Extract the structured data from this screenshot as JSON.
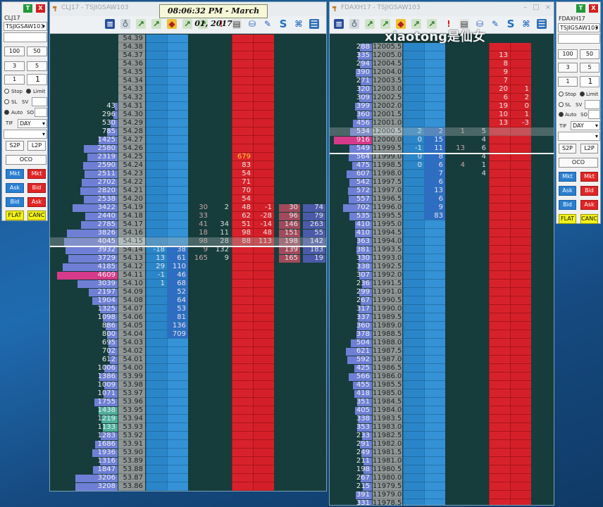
{
  "left_sidebar": {
    "symbol": "CLJ17",
    "account": "TSJIGSAW103",
    "qty_buttons": [
      "100",
      "50",
      "3",
      "5",
      "1"
    ],
    "qty_value": "1",
    "stop_label": "Stop",
    "limit_label": "Limit",
    "sl_label": "SL",
    "sv_label": "SV",
    "auto_label": "Auto",
    "so_label": "SO",
    "tif_label": "TIF",
    "tif_value": "DAY",
    "s2p": "S2P",
    "l2p": "L2P",
    "oco": "OCO",
    "mkt_buy": "Mkt",
    "mkt_sell": "Mkt",
    "ask_buy": "Ask",
    "bid_sell": "Bid",
    "bid_buy": "Bid",
    "ask_sell": "Ask",
    "flat": "FLAT",
    "canc": "CANC"
  },
  "right_sidebar": {
    "symbol": "FDAXH17",
    "account": "TSJIGSAW103",
    "qty_buttons": [
      "100",
      "50",
      "3",
      "5",
      "1"
    ],
    "qty_value": "1",
    "stop_label": "Stop",
    "limit_label": "Limit",
    "sl_label": "SL",
    "sv_label": "SV",
    "auto_label": "Auto",
    "so_label": "SO",
    "tif_label": "TIF",
    "tif_value": "DAY",
    "s2p": "S2P",
    "l2p": "L2P",
    "oco": "OCO",
    "mkt_buy": "Mkt",
    "mkt_sell": "Mkt",
    "ask_buy": "Ask",
    "bid_sell": "Bid",
    "bid_buy": "Bid",
    "ask_sell": "Ask",
    "flat": "FLAT",
    "canc": "CANC"
  },
  "window_left": {
    "title": "CLJ17 - TSJIGSAW103"
  },
  "window_right": {
    "title": "FDAXH17 - TSJIGSAW103"
  },
  "clock": "08:06:32 PM - March 01, 2017",
  "watermark": "xiaotong是仙女",
  "colors": {
    "ask": "#2b86c9",
    "bid": "#d8222b",
    "price": "#8e9696",
    "bg": "#173c3c",
    "volbar": "#6f7fd6"
  },
  "ladder_left": {
    "rows": [
      {
        "vol": "",
        "p": "54.39"
      },
      {
        "vol": "",
        "p": "54.38"
      },
      {
        "vol": "",
        "p": "54.37"
      },
      {
        "vol": "",
        "p": "54.36"
      },
      {
        "vol": "",
        "p": "54.35"
      },
      {
        "vol": "",
        "p": "54.34"
      },
      {
        "vol": "",
        "p": "54.33"
      },
      {
        "vol": "",
        "p": "54.32"
      },
      {
        "vol": "43",
        "p": "54.31"
      },
      {
        "vol": "296",
        "p": "54.30"
      },
      {
        "vol": "530",
        "p": "54.29"
      },
      {
        "vol": "785",
        "p": "54.28"
      },
      {
        "vol": "1425",
        "p": "54.27"
      },
      {
        "vol": "2580",
        "p": "54.26"
      },
      {
        "vol": "2319",
        "p": "54.25",
        "b1": "679"
      },
      {
        "vol": "2590",
        "p": "54.24",
        "b1": "83"
      },
      {
        "vol": "2511",
        "p": "54.23",
        "b1": "54"
      },
      {
        "vol": "2702",
        "p": "54.22",
        "b1": "71"
      },
      {
        "vol": "2820",
        "p": "54.21",
        "b1": "70"
      },
      {
        "vol": "2538",
        "p": "54.20",
        "b1": "54"
      },
      {
        "vol": "3422",
        "p": "54.19",
        "c1": "30",
        "c2": "2",
        "b1": "48",
        "b2": "-1",
        "d1": "30",
        "d2": "74"
      },
      {
        "vol": "2440",
        "p": "54.18",
        "c1": "33",
        "b1": "62",
        "b2": "-28",
        "d1": "96",
        "d2": "79"
      },
      {
        "vol": "2785",
        "p": "54.17",
        "c1": "41",
        "c2": "34",
        "b1": "51",
        "b2": "-14",
        "d1": "146",
        "d2": "263"
      },
      {
        "vol": "3826",
        "p": "54.16",
        "c1": "18",
        "c2": "11",
        "b1": "98",
        "b2": "48",
        "d1": "151",
        "d2": "55"
      },
      {
        "vol": "4045",
        "p": "54.15",
        "c1": "98",
        "c2": "28",
        "b1": "88",
        "b2": "113",
        "d1": "198",
        "d2": "142"
      },
      {
        "vol": "3932",
        "p": "54.14",
        "a1": "-18",
        "a2": "38",
        "c1": "9",
        "c2": "132",
        "d1": "139",
        "d2": "183"
      },
      {
        "vol": "3729",
        "p": "54.13",
        "a1": "13",
        "a2": "61",
        "c1": "165",
        "c2": "9",
        "d1": "165",
        "d2": "19"
      },
      {
        "vol": "4185",
        "p": "54.12",
        "a1": "29",
        "a2": "110"
      },
      {
        "vol": "4609",
        "p": "54.11",
        "a1": "-1",
        "a2": "46"
      },
      {
        "vol": "3039",
        "p": "54.10",
        "a1": "1",
        "a2": "68"
      },
      {
        "vol": "2197",
        "p": "54.09",
        "a2": "52"
      },
      {
        "vol": "1904",
        "p": "54.08",
        "a2": "64"
      },
      {
        "vol": "1325",
        "p": "54.07",
        "a2": "53"
      },
      {
        "vol": "1098",
        "p": "54.06",
        "a2": "81"
      },
      {
        "vol": "886",
        "p": "54.05",
        "a2": "136"
      },
      {
        "vol": "800",
        "p": "54.04",
        "a2": "709"
      },
      {
        "vol": "695",
        "p": "54.03"
      },
      {
        "vol": "702",
        "p": "54.02"
      },
      {
        "vol": "612",
        "p": "54.01"
      },
      {
        "vol": "1006",
        "p": "54.00"
      },
      {
        "vol": "1386",
        "p": "53.99"
      },
      {
        "vol": "1009",
        "p": "53.98"
      },
      {
        "vol": "1071",
        "p": "53.97"
      },
      {
        "vol": "1755",
        "p": "53.96"
      },
      {
        "vol": "1438",
        "p": "53.95"
      },
      {
        "vol": "1219",
        "p": "53.94"
      },
      {
        "vol": "1133",
        "p": "53.93"
      },
      {
        "vol": "1283",
        "p": "53.92"
      },
      {
        "vol": "1686",
        "p": "53.91"
      },
      {
        "vol": "1936",
        "p": "53.90"
      },
      {
        "vol": "1316",
        "p": "53.89"
      },
      {
        "vol": "1847",
        "p": "53.88"
      },
      {
        "vol": "3206",
        "p": "53.87"
      },
      {
        "vol": "3208",
        "p": "53.86"
      }
    ]
  },
  "ladder_right": {
    "rows": [
      {
        "vol": "288",
        "p": "12005.5"
      },
      {
        "vol": "335",
        "p": "12005.0",
        "b1": "13"
      },
      {
        "vol": "294",
        "p": "12004.5",
        "b1": "8"
      },
      {
        "vol": "390",
        "p": "12004.0",
        "b1": "9"
      },
      {
        "vol": "271",
        "p": "12003.5",
        "b1": "7"
      },
      {
        "vol": "320",
        "p": "12003.0",
        "b1": "20",
        "b2": "1"
      },
      {
        "vol": "309",
        "p": "12002.5",
        "b1": "6",
        "b2": "2"
      },
      {
        "vol": "399",
        "p": "12002.0",
        "b1": "19",
        "b2": "0"
      },
      {
        "vol": "360",
        "p": "12001.5",
        "b1": "10",
        "b2": "1"
      },
      {
        "vol": "456",
        "p": "12001.0",
        "b1": "13",
        "b2": "-3"
      },
      {
        "vol": "534",
        "p": "12000.5",
        "a1": "2",
        "a2": "2",
        "c1": "1",
        "c2": "5"
      },
      {
        "vol": "916",
        "p": "12000.0",
        "a1": "0",
        "a2": "15",
        "c2": "4"
      },
      {
        "vol": "549",
        "p": "11999.5",
        "a1": "-1",
        "a2": "11",
        "c1": "13",
        "c2": "6"
      },
      {
        "vol": "564",
        "p": "11999.0",
        "a1": "0",
        "a2": "8",
        "c2": "4"
      },
      {
        "vol": "475",
        "p": "11998.5",
        "a1": "0",
        "a2": "6",
        "c1": "4",
        "c2": "1"
      },
      {
        "vol": "607",
        "p": "11998.0",
        "a2": "7",
        "c2": "4"
      },
      {
        "vol": "542",
        "p": "11997.5",
        "a2": "6"
      },
      {
        "vol": "572",
        "p": "11997.0",
        "a2": "13"
      },
      {
        "vol": "557",
        "p": "11996.5",
        "a2": "6"
      },
      {
        "vol": "702",
        "p": "11996.0",
        "a2": "9"
      },
      {
        "vol": "535",
        "p": "11995.5",
        "a2": "83"
      },
      {
        "vol": "410",
        "p": "11995.0"
      },
      {
        "vol": "410",
        "p": "11994.5"
      },
      {
        "vol": "363",
        "p": "11994.0"
      },
      {
        "vol": "381",
        "p": "11993.5"
      },
      {
        "vol": "330",
        "p": "11993.0"
      },
      {
        "vol": "338",
        "p": "11992.5"
      },
      {
        "vol": "307",
        "p": "11992.0"
      },
      {
        "vol": "236",
        "p": "11991.5"
      },
      {
        "vol": "299",
        "p": "11991.0"
      },
      {
        "vol": "267",
        "p": "11990.5"
      },
      {
        "vol": "317",
        "p": "11990.0"
      },
      {
        "vol": "337",
        "p": "11989.5"
      },
      {
        "vol": "360",
        "p": "11989.0"
      },
      {
        "vol": "378",
        "p": "11988.5"
      },
      {
        "vol": "504",
        "p": "11988.0"
      },
      {
        "vol": "621",
        "p": "11987.5"
      },
      {
        "vol": "592",
        "p": "11987.0"
      },
      {
        "vol": "425",
        "p": "11986.5"
      },
      {
        "vol": "566",
        "p": "11986.0"
      },
      {
        "vol": "455",
        "p": "11985.5"
      },
      {
        "vol": "418",
        "p": "11985.0"
      },
      {
        "vol": "351",
        "p": "11984.5"
      },
      {
        "vol": "405",
        "p": "11984.0"
      },
      {
        "vol": "338",
        "p": "11983.5"
      },
      {
        "vol": "353",
        "p": "11983.0"
      },
      {
        "vol": "233",
        "p": "11982.5"
      },
      {
        "vol": "291",
        "p": "11982.0"
      },
      {
        "vol": "249",
        "p": "11981.5"
      },
      {
        "vol": "211",
        "p": "11981.0"
      },
      {
        "vol": "198",
        "p": "11980.5"
      },
      {
        "vol": "267",
        "p": "11980.0"
      },
      {
        "vol": "215",
        "p": "11979.5"
      },
      {
        "vol": "391",
        "p": "11979.0"
      },
      {
        "vol": "331",
        "p": "11978.5"
      }
    ]
  }
}
